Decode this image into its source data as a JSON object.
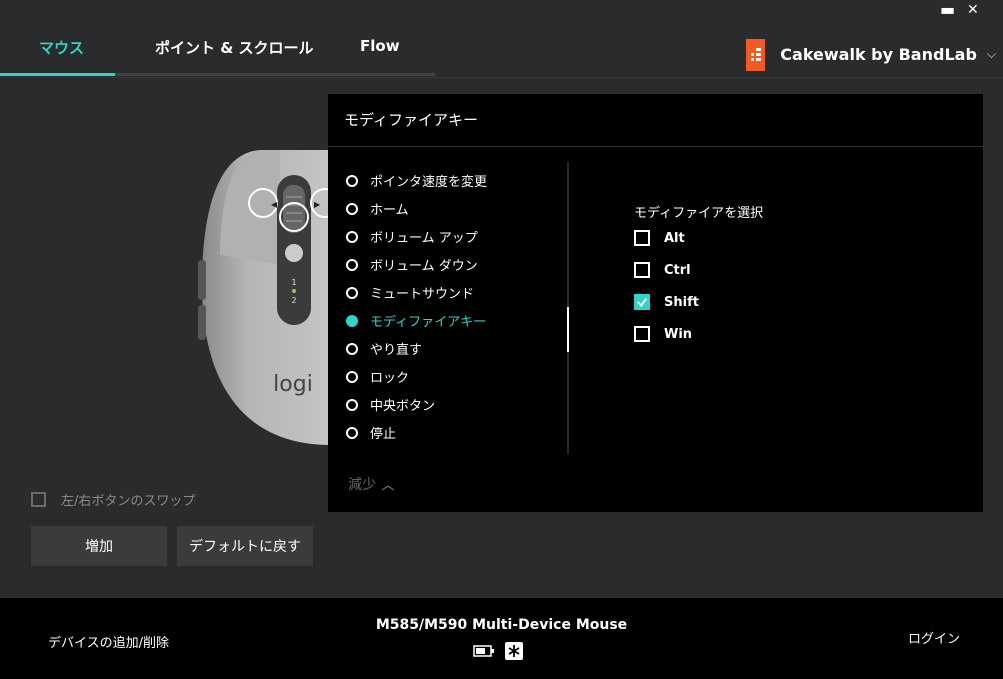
{
  "window": {
    "minimize": "▬",
    "close": "✕"
  },
  "tabs": [
    {
      "label": "マウス",
      "active": true
    },
    {
      "label": "ポイント & スクロール",
      "active": false
    },
    {
      "label": "Flow",
      "active": false
    }
  ],
  "app_selector": {
    "name": "Cakewalk by BandLab",
    "icon": "cakewalk-logo",
    "accent": "#f15a24"
  },
  "mouse": {
    "brand": "logi",
    "channels": [
      "1",
      "2"
    ]
  },
  "swap": {
    "label": "左/右ボタンのスワップ",
    "checked": false
  },
  "buttons": {
    "add": "増加",
    "default": "デフォルトに戻す"
  },
  "panel": {
    "title": "モディファイアキー",
    "options": [
      {
        "label": "ポインタ速度を変更"
      },
      {
        "label": "ホーム"
      },
      {
        "label": "ボリューム アップ"
      },
      {
        "label": "ボリューム ダウン"
      },
      {
        "label": "ミュートサウンド"
      },
      {
        "label": "モディファイアキー",
        "selected": true
      },
      {
        "label": "やり直す"
      },
      {
        "label": "ロック"
      },
      {
        "label": "中央ボタン"
      },
      {
        "label": "停止"
      }
    ],
    "less_label": "減少",
    "modifier_title": "モディファイアを選択",
    "modifiers": [
      {
        "label": "Alt",
        "checked": false
      },
      {
        "label": "Ctrl",
        "checked": false
      },
      {
        "label": "Shift",
        "checked": true
      },
      {
        "label": "Win",
        "checked": false
      }
    ]
  },
  "footer": {
    "add_remove": "デバイスの追加/削除",
    "device_name": "M585/M590 Multi-Device Mouse",
    "login": "ログイン"
  },
  "colors": {
    "accent": "#34d3c8",
    "background": "#2a2b2c",
    "panel": "#000000"
  }
}
